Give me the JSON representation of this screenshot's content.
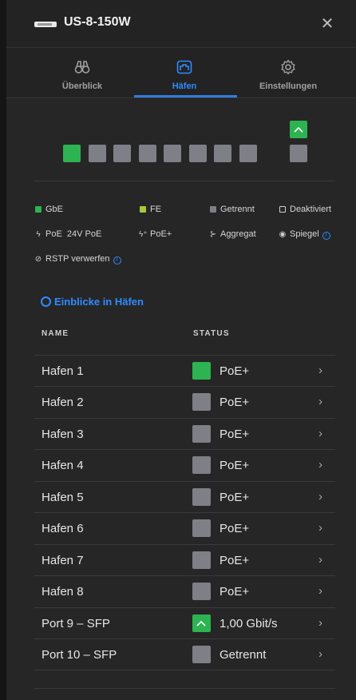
{
  "header": {
    "title": "US-8-150W",
    "close_icon": "close-icon"
  },
  "tabs": [
    {
      "label": "Überblick",
      "icon": "binoculars-icon",
      "active": false
    },
    {
      "label": "Häfen",
      "icon": "ports-icon",
      "active": true
    },
    {
      "label": "Einstellungen",
      "icon": "gear-icon",
      "active": false
    }
  ],
  "port_map": {
    "ports": [
      "green",
      "gray",
      "gray",
      "gray",
      "gray",
      "gray",
      "gray",
      "gray"
    ],
    "sfp": [
      "green-up",
      "gray"
    ]
  },
  "legend": {
    "gbe": "GbE",
    "fe": "FE",
    "getrennt": "Getrennt",
    "deaktiviert": "Deaktiviert",
    "poe": "PoE",
    "poe24": "24V PoE",
    "poeplus": "PoE+",
    "aggregat": "Aggregat",
    "spiegel": "Spiegel",
    "rstp": "RSTP verwerfen"
  },
  "insights": {
    "label": "Einblicke in Häfen"
  },
  "table": {
    "col_name": "NAME",
    "col_status": "STATUS",
    "rows": [
      {
        "name": "Hafen 1",
        "status": "PoE+",
        "color": "green"
      },
      {
        "name": "Hafen 2",
        "status": "PoE+",
        "color": "gray"
      },
      {
        "name": "Hafen 3",
        "status": "PoE+",
        "color": "gray"
      },
      {
        "name": "Hafen 4",
        "status": "PoE+",
        "color": "gray"
      },
      {
        "name": "Hafen 5",
        "status": "PoE+",
        "color": "gray"
      },
      {
        "name": "Hafen 6",
        "status": "PoE+",
        "color": "gray"
      },
      {
        "name": "Hafen 7",
        "status": "PoE+",
        "color": "gray"
      },
      {
        "name": "Hafen 8",
        "status": "PoE+",
        "color": "gray"
      },
      {
        "name": "Port 9 – SFP",
        "status": "1,00 Gbit/s",
        "color": "green-up"
      },
      {
        "name": "Port 10 – SFP",
        "status": "Getrennt",
        "color": "gray"
      }
    ]
  },
  "colors": {
    "accent": "#2f8cff",
    "green": "#2db351",
    "gray": "#7f7f88",
    "fe": "#a6c93a"
  }
}
